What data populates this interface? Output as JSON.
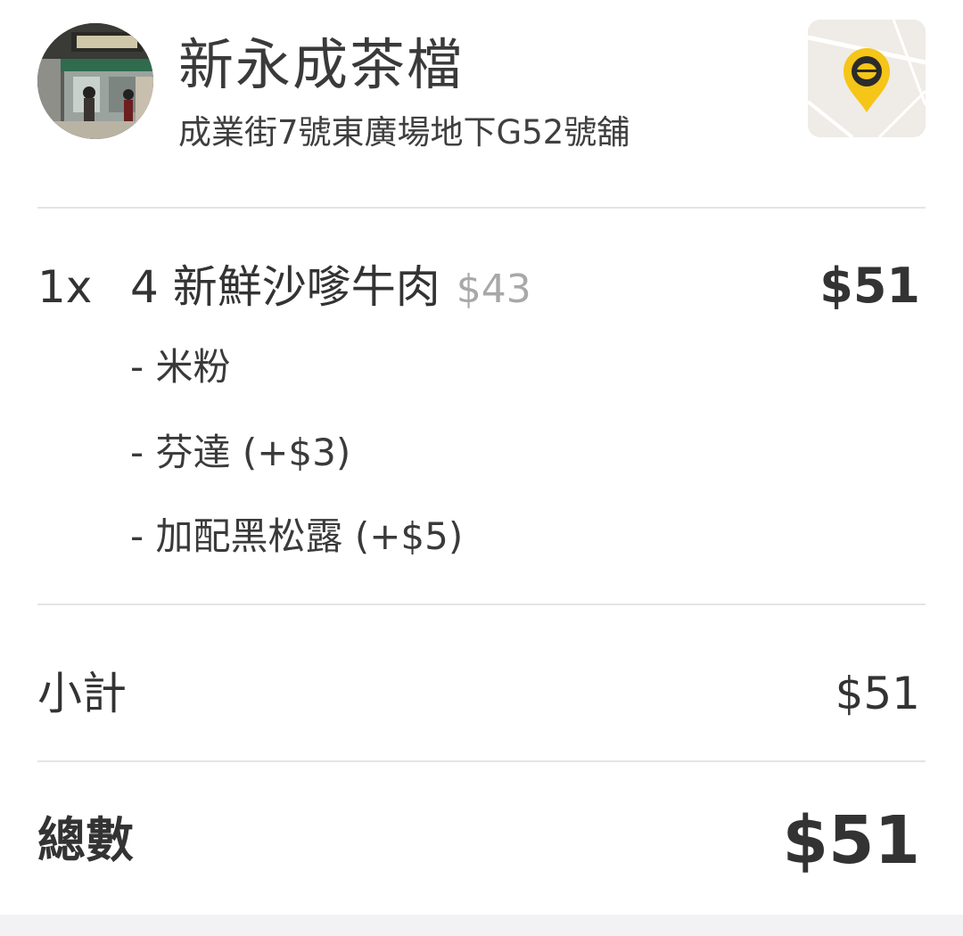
{
  "store": {
    "name": "新永成茶檔",
    "address": "成業街7號東廣場地下G52號舖",
    "pin_color": "#f5c518"
  },
  "order": {
    "items": [
      {
        "qty": "1x",
        "name": "4 新鮮沙嗲牛肉",
        "unit_price": "$43",
        "total": "$51",
        "options": [
          "- 米粉",
          "- 芬達 (+$3)",
          "- 加配黑松露 (+$5)"
        ]
      }
    ]
  },
  "summary": {
    "subtotal_label": "小計",
    "subtotal_value": "$51",
    "total_label": "總數",
    "total_value": "$51"
  }
}
